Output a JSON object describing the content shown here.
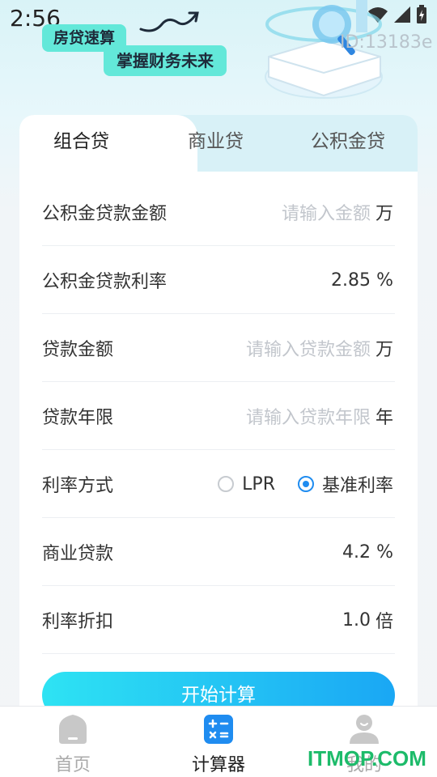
{
  "status_bar": {
    "time": "2:56"
  },
  "banner": {
    "tag1": "房贷速算",
    "tag2": "掌握财务未来",
    "id_text": "ID:13183e"
  },
  "tabs": [
    {
      "label": "组合贷",
      "active": true
    },
    {
      "label": "商业贷",
      "active": false
    },
    {
      "label": "公积金贷",
      "active": false
    }
  ],
  "form": {
    "fund_amount": {
      "label": "公积金贷款金额",
      "placeholder": "请输入金额",
      "unit": "万"
    },
    "fund_rate": {
      "label": "公积金贷款利率",
      "value": "2.85",
      "unit": "%"
    },
    "loan_amount": {
      "label": "贷款金额",
      "placeholder": "请输入贷款金额",
      "unit": "万"
    },
    "loan_years": {
      "label": "贷款年限",
      "placeholder": "请输入贷款年限",
      "unit": "年"
    },
    "rate_mode": {
      "label": "利率方式",
      "options": [
        {
          "label": "LPR",
          "selected": false
        },
        {
          "label": "基准利率",
          "selected": true
        }
      ]
    },
    "commercial_loan": {
      "label": "商业贷款",
      "value": "4.2",
      "unit": "%"
    },
    "rate_discount": {
      "label": "利率折扣",
      "value": "1.0",
      "unit": "倍"
    }
  },
  "calculate_button": "开始计算",
  "bottom_nav": [
    {
      "label": "首页",
      "icon": "home-icon",
      "active": false
    },
    {
      "label": "计算器",
      "icon": "calculator-icon",
      "active": true
    },
    {
      "label": "我的",
      "icon": "user-icon",
      "active": false
    }
  ],
  "watermark": "ITMOP.COM",
  "colors": {
    "accent": "#1f8cf0",
    "tag_bg": "#63e8d9",
    "button_start": "#2ee3f3",
    "button_end": "#1aa7f4",
    "watermark": "#1dbb6a"
  }
}
